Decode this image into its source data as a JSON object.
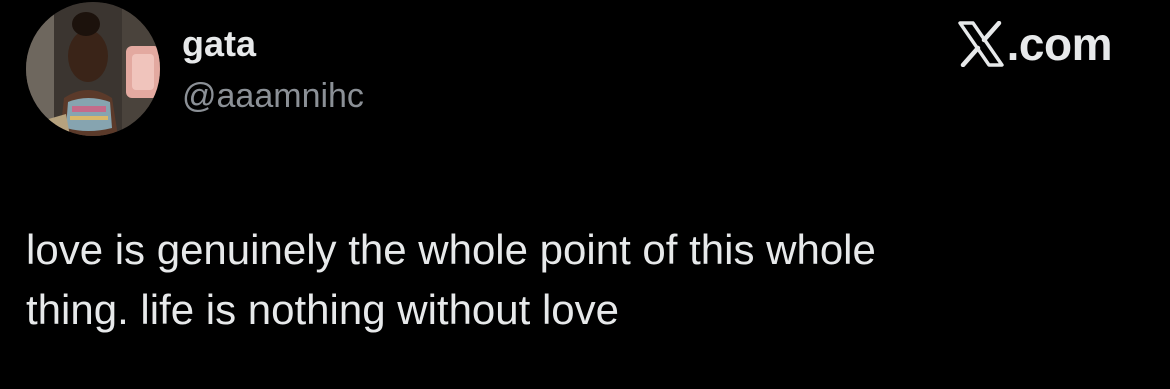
{
  "author": {
    "display_name": "gata",
    "handle": "@aaamnihc"
  },
  "brand": {
    "logo_icon": "x-logo-icon",
    "domain_suffix": ".com"
  },
  "tweet": {
    "lines": [
      "love is genuinely the whole point of this whole",
      "thing. life is nothing without love"
    ]
  },
  "colors": {
    "background": "#000000",
    "primary_text": "#e7e9ea",
    "secondary_text": "#8b9096"
  }
}
